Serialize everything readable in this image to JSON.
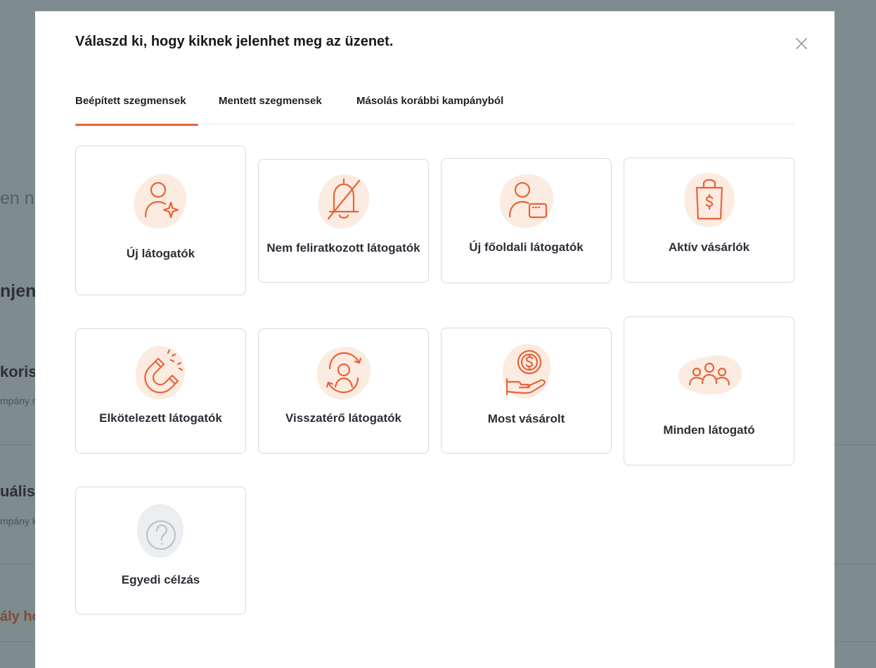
{
  "background": {
    "fragments": [
      "en n",
      "njen",
      "koris",
      "mpány r",
      "uális",
      "mpány k",
      "ály ho"
    ]
  },
  "modal": {
    "title": "Válaszd ki, hogy kiknek jelenhet meg az üzenet.",
    "tabs": [
      {
        "label": "Beépített szegmensek",
        "active": true
      },
      {
        "label": "Mentett szegmensek",
        "active": false
      },
      {
        "label": "Másolás korábbi kampányból",
        "active": false
      }
    ],
    "segments": [
      {
        "label": "Új látogatók",
        "icon": "user-sparkle-icon"
      },
      {
        "label": "Nem feliratkozott látogatók",
        "icon": "bell-off-icon"
      },
      {
        "label": "Új főoldali látogatók",
        "icon": "user-browser-icon"
      },
      {
        "label": "Aktív vásárlók",
        "icon": "shopping-bag-dollar-icon"
      },
      {
        "label": "Elkötelezett látogatók",
        "icon": "magnet-icon"
      },
      {
        "label": "Visszatérő látogatók",
        "icon": "user-refresh-icon"
      },
      {
        "label": "Most vásárolt",
        "icon": "hand-coin-icon"
      },
      {
        "label": "Minden látogató",
        "icon": "users-group-icon"
      },
      {
        "label": "Egyedi célzás",
        "icon": "question-circle-icon"
      }
    ]
  },
  "colors": {
    "accent": "#e8633b",
    "icon_blob": "#fcebe0",
    "custom_blob": "#eceef1",
    "custom_icon": "#b9bec6",
    "overlay": "#7e8c8f"
  }
}
